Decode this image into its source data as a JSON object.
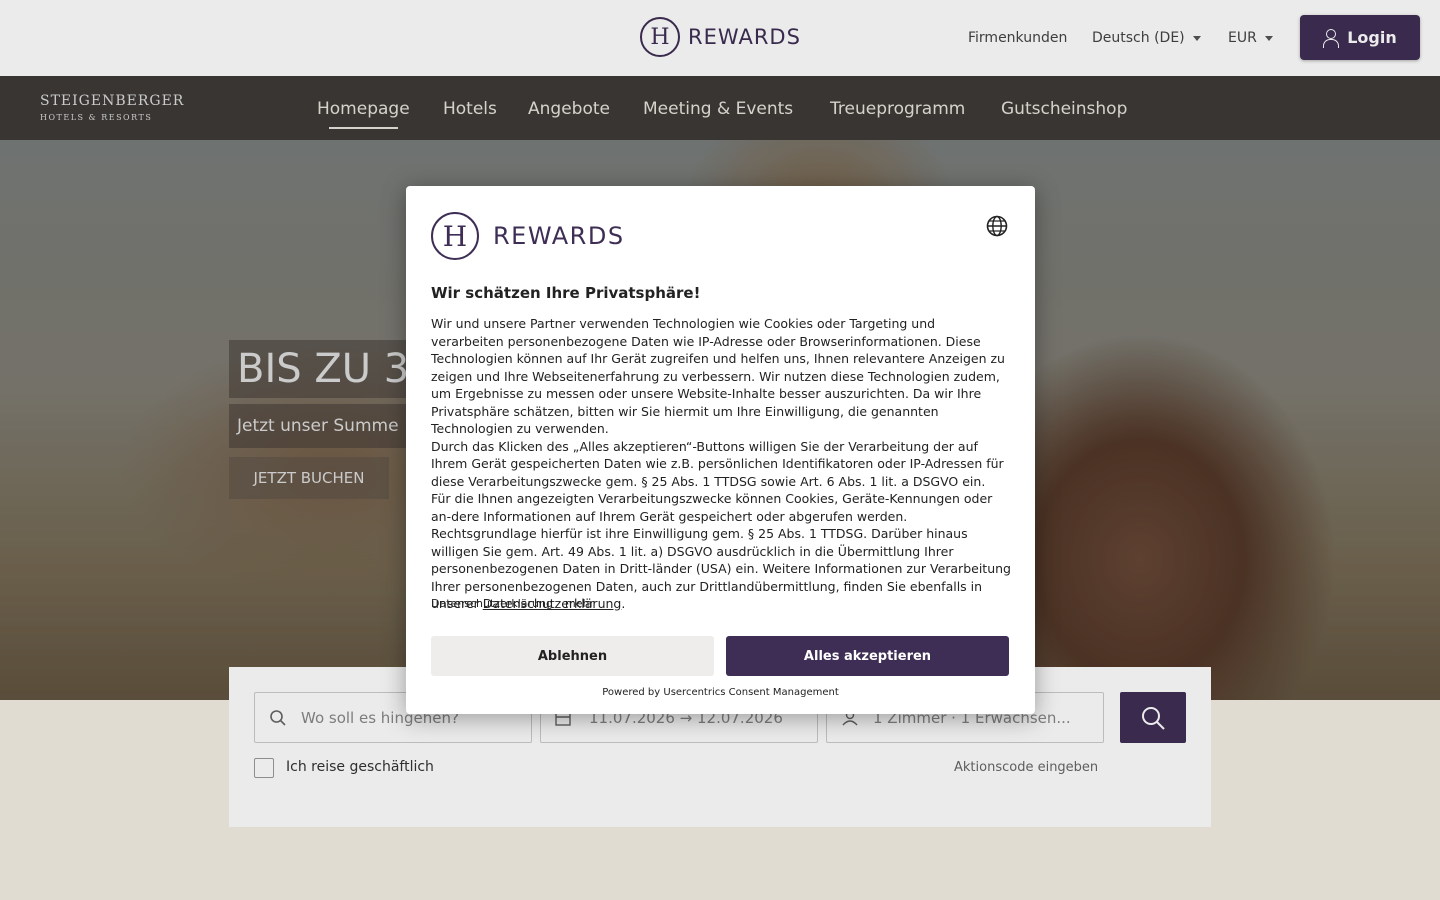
{
  "header": {
    "logo_letter": "H",
    "logo_text": "REWARDS",
    "links": {
      "corporate": "Firmenkunden",
      "language": "Deutsch (DE)",
      "currency": "EUR"
    },
    "login_label": "Login"
  },
  "nav": {
    "logo_main": "STEIGENBERGER",
    "logo_sub": "HOTELS & RESORTS",
    "items": [
      {
        "label": "Homepage"
      },
      {
        "label": "Hotels"
      },
      {
        "label": "Angebote"
      },
      {
        "label": "Meeting & Events"
      },
      {
        "label": "Treueprogramm"
      },
      {
        "label": "Gutscheinshop"
      }
    ]
  },
  "hero": {
    "headline": "BIS ZU 3",
    "subline": "Jetzt unser Summe",
    "cta": "JETZT BUCHEN"
  },
  "booking": {
    "destination_placeholder": "Wo soll es hingehen?",
    "dates": "11.07.2026 → 12.07.2026",
    "guests": "1 Zimmer · 1 Erwachsen...",
    "business_label": "Ich reise geschäftlich",
    "promo_label": "Aktionscode eingeben"
  },
  "consent": {
    "logo_letter": "H",
    "logo_text": "REWARDS",
    "title": "Wir schätzen Ihre Privatsphäre!",
    "paragraph1": "Wir und unsere Partner verwenden Technologien wie Cookies oder Targeting und verarbeiten personenbezogene Daten wie IP-Adresse oder Browserinformationen. Diese Technologien können auf Ihr Gerät zugreifen und helfen uns, Ihnen relevantere Anzeigen zu zeigen und Ihre Webseitenerfahrung zu verbessern. Wir nutzen diese Technologien zudem, um Ergebnisse zu messen oder unsere Website-Inhalte besser auszurichten. Da wir Ihre Privatsphäre schätzen, bitten wir Sie hiermit um Ihre Einwilligung, die genannten Technologien zu verwenden.",
    "paragraph2": "Durch das Klicken des „Alles akzeptieren“-Buttons willigen Sie der Verarbeitung der auf Ihrem Gerät gespeicherten Daten wie z.B. persönlichen Identifikatoren oder IP-Adressen für diese Verarbeitungszwecke gem. § 25 Abs. 1 TTDSG sowie Art. 6 Abs. 1 lit. a DSGVO ein.",
    "paragraph3": "Für die Ihnen angezeigten Verarbeitungszwecke können Cookies, Geräte-Kennungen oder an-dere Informationen auf Ihrem Gerät gespeichert oder abgerufen werden. Rechtsgrundlage hierfür ist ihre Einwilligung gem. § 25 Abs. 1 TTDSG. Darüber hinaus willigen Sie gem. Art. 49 Abs. 1 lit. a) DSGVO ausdrücklich in die Übermittlung Ihrer personenbezogenen Daten in Dritt-länder (USA) ein. Weitere Informationen zur Verarbeitung Ihrer personenbezogenen Daten, auch zur Drittlandübermittlung, finden Sie ebenfalls in unserer",
    "privacy_link": "Datenschutzerklärung",
    "period": ".",
    "footer_links": [
      "Datenschutzerklärung",
      "mehr"
    ],
    "deny_label": "Ablehnen",
    "accept_label": "Alles akzeptieren",
    "powered_by": "Powered by Usercentrics Consent Management"
  },
  "colors": {
    "brand": "#3e2e55",
    "nav_bg": "#3d3a37",
    "page_bg": "#f4efe4"
  },
  "icons": [
    "user-icon",
    "search-icon",
    "calendar-icon",
    "guests-icon",
    "globe-icon",
    "caret-down-icon"
  ]
}
